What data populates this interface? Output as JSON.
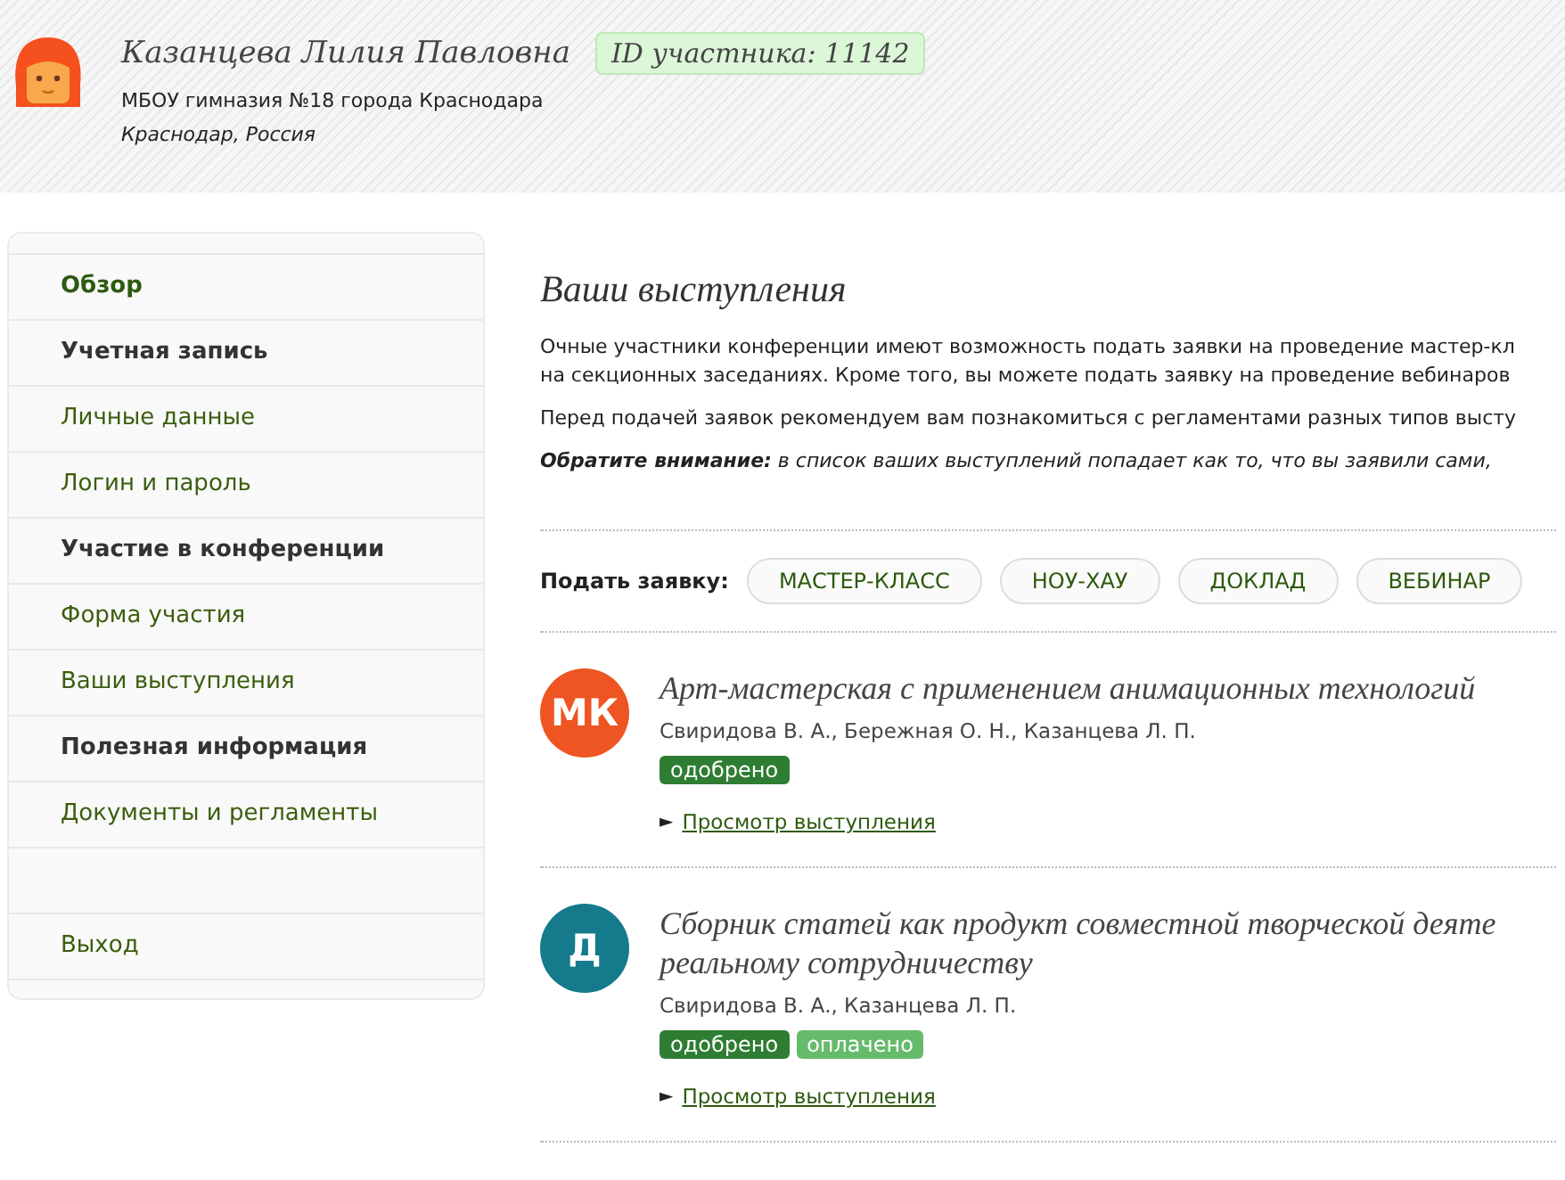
{
  "profile": {
    "name": "Казанцева Лилия Павловна",
    "id_badge": "ID участника: 11142",
    "organization": "МБОУ гимназия №18 города Краснодара",
    "location": "Краснодар, Россия"
  },
  "sidebar": {
    "items": [
      {
        "kind": "main",
        "label": "Обзор"
      },
      {
        "kind": "section",
        "label": "Учетная запись"
      },
      {
        "kind": "link",
        "label": "Личные данные"
      },
      {
        "kind": "link",
        "label": "Логин и пароль"
      },
      {
        "kind": "section",
        "label": "Участие в конференции"
      },
      {
        "kind": "link",
        "label": "Форма участия"
      },
      {
        "kind": "link",
        "label": "Ваши выступления"
      },
      {
        "kind": "section",
        "label": "Полезная информация"
      },
      {
        "kind": "link",
        "label": "Документы и регламенты"
      },
      {
        "kind": "spacer"
      },
      {
        "kind": "link",
        "label": "Выход"
      }
    ]
  },
  "main": {
    "title": "Ваши выступления",
    "intro_lines": [
      "Очные участники конференции имеют возможность подать заявки на проведение мастер-кл",
      "на секционных заседаниях. Кроме того, вы можете подать заявку на проведение вебинаров"
    ],
    "recommendation": "Перед подачей заявок рекомендуем вам познакомиться с регламентами разных типов высту",
    "note": "**Обратите внимание:** в список ваших выступлений попадает как то, что вы заявили сами,",
    "apply_label": "Подать заявку:",
    "apply_buttons": [
      "МАСТЕР-КЛАСС",
      "НОУ-ХАУ",
      "ДОКЛАД",
      "ВЕБИНАР"
    ],
    "talks": [
      {
        "initials": "МК",
        "color": "#ee5522",
        "title_lines": [
          "Арт-мастерская с применением анимационных технологий"
        ],
        "authors": "Свиридова В. А., Бережная О. Н., Казанцева Л. П.",
        "statuses": [
          {
            "kind": "approved",
            "label": "одобрено"
          }
        ],
        "link": "Просмотр выступления",
        "toggle": "►"
      },
      {
        "initials": "Д",
        "color": "#157a8c",
        "title_lines": [
          "Сборник статей как продукт совместной творческой деяте",
          "реальному сотрудничеству"
        ],
        "authors": "Свиридова В. А., Казанцева Л. П.",
        "statuses": [
          {
            "kind": "approved",
            "label": "одобрено"
          },
          {
            "kind": "paid",
            "label": "оплачено"
          }
        ],
        "link": "Просмотр выступления",
        "toggle": "►"
      }
    ]
  }
}
